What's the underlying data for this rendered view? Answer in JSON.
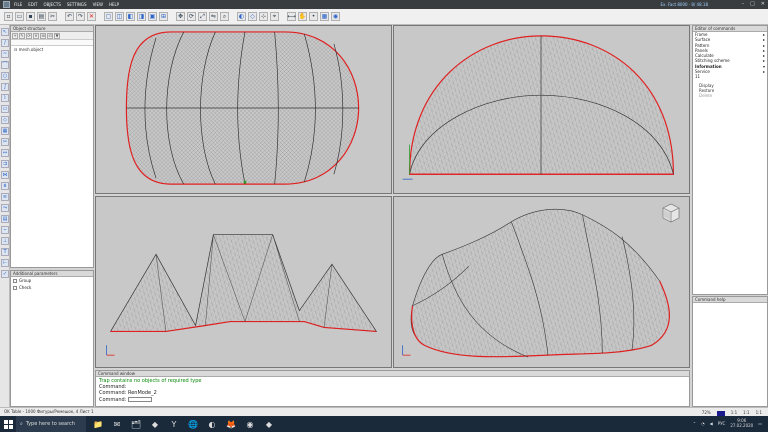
{
  "menubar": {
    "menus": [
      "FILE",
      "EDIT",
      "OBJECTS",
      "SETTINGS",
      "VIEW",
      "HELP"
    ],
    "info": "Eх. Fact 8000 · 8/ 48.18",
    "win_buttons": [
      "–",
      "□",
      "✕"
    ]
  },
  "left_panel": {
    "title": "Object structure",
    "tree_item": "mesh.object"
  },
  "params_panel": {
    "title": "Additional parameters",
    "rows": [
      "Group",
      "Check"
    ]
  },
  "right_panel": {
    "title": "Editor of commands",
    "sections": [
      {
        "label": "Frame",
        "arrow": "▸"
      },
      {
        "label": "Surface",
        "arrow": "▸"
      },
      {
        "label": "Pattern",
        "arrow": "▸"
      },
      {
        "label": "Panels",
        "arrow": "▸"
      },
      {
        "label": "Calculate",
        "arrow": "▸"
      },
      {
        "label": "Stitching scheme",
        "arrow": "▸"
      },
      {
        "label": "Information",
        "arrow": "▾",
        "bold": true
      },
      {
        "label": "Service",
        "arrow": "▸"
      },
      {
        "label": "11",
        "arrow": ""
      }
    ],
    "subitems": [
      {
        "label": "Display",
        "dim": false
      },
      {
        "label": "Restore",
        "dim": false
      },
      {
        "label": "Delete",
        "dim": true
      }
    ]
  },
  "cmd_help": {
    "title": "Command help"
  },
  "command_window": {
    "title": "Command window",
    "lines": [
      {
        "text": "Trap contains no objects of required type",
        "warn": true
      },
      {
        "text": "Command:",
        "warn": false
      },
      {
        "text": "Command: RenMode_2",
        "warn": false
      }
    ],
    "prompt": "Command:"
  },
  "statusbar": {
    "left": "OK Table - 1000 Фигуры/Ремешок, 4 Лист 1",
    "zoom": "72%",
    "buttons": [
      "1:1",
      "1:1",
      "1:1"
    ]
  },
  "taskbar": {
    "search_text": "Type here to search",
    "apps": [
      "📁",
      "✉",
      "🗂",
      "◆",
      "Y",
      "🌐",
      "◐",
      "🦊",
      "◉",
      "◆"
    ],
    "lang": "РУС",
    "time": "9:06",
    "date": "27.02.2020"
  },
  "colors": {
    "accent": "#2a62c9",
    "outline": "#e02020",
    "mesh": "#8a8a8a",
    "viewport_bg": "#c8c8c8"
  }
}
